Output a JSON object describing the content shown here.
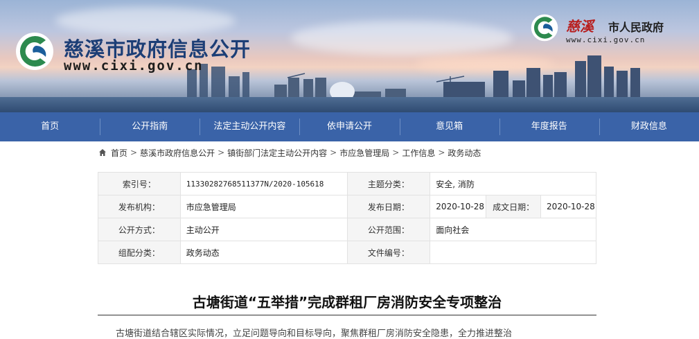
{
  "header": {
    "site_title": "慈溪市政府信息公开",
    "site_url": "www.cixi.gov.cn",
    "gov_brand": "慈溪",
    "gov_name": "市人民政府",
    "gov_url": "www.cixi.gov.cn",
    "logo_color": "#2d8a4e"
  },
  "nav": {
    "items": [
      "首页",
      "公开指南",
      "法定主动公开内容",
      "依申请公开",
      "意见箱",
      "年度报告",
      "财政信息"
    ],
    "bg_color": "#3a63a8"
  },
  "breadcrumb": {
    "items": [
      "首页",
      "慈溪市政府信息公开",
      "镇街部门法定主动公开内容",
      "市应急管理局",
      "工作信息",
      "政务动态"
    ],
    "separator": ">"
  },
  "info_table": {
    "index_label": "索引号：",
    "index_value": "11330282768511377N/2020-105618",
    "topic_label": "主题分类：",
    "topic_value": "安全, 消防",
    "publisher_label": "发布机构：",
    "publisher_value": "市应急管理局",
    "pub_date_label": "发布日期：",
    "pub_date_value": "2020-10-28",
    "create_date_label": "成文日期：",
    "create_date_value": "2020-10-28",
    "method_label": "公开方式：",
    "method_value": "主动公开",
    "scope_label": "公开范围：",
    "scope_value": "面向社会",
    "category_label": "组配分类：",
    "category_value": "政务动态",
    "doc_no_label": "文件编号：",
    "doc_no_value": ""
  },
  "article": {
    "title": "古塘街道“五举措”完成群租厂房消防安全专项整治",
    "body_first_line": "古塘街道结合辖区实际情况，立足问题导向和目标导向，聚焦群租厂房消防安全隐患，全力推进整治"
  }
}
